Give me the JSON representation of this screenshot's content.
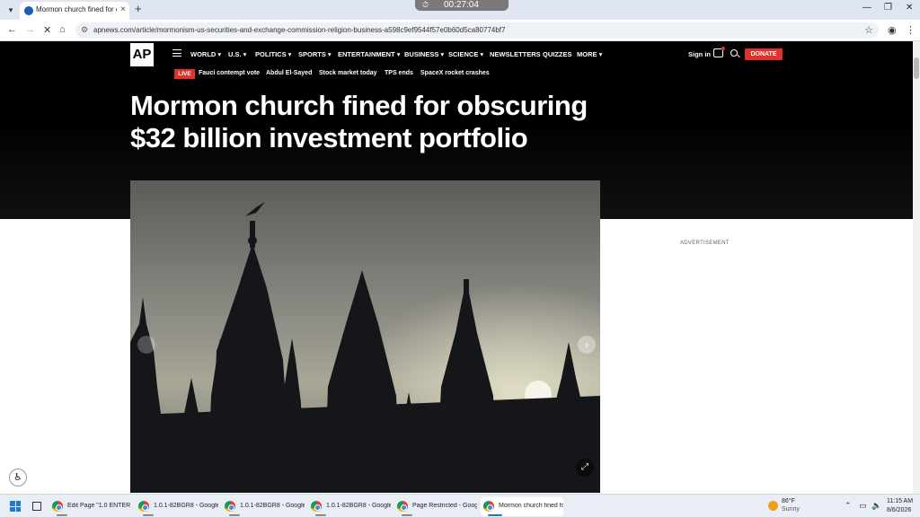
{
  "browser": {
    "tab_title": "Mormon church fined for obsc",
    "timer": "00:27:04",
    "url": "apnews.com/article/mormonism-us-securities-and-exchange-commission-religion-business-a598c9ef9544f57e0b60d5ca80774bf7"
  },
  "site": {
    "logo": "AP",
    "nav": [
      "WORLD",
      "U.S.",
      "POLITICS",
      "SPORTS",
      "ENTERTAINMENT",
      "BUSINESS",
      "SCIENCE",
      "NEWSLETTERS",
      "QUIZZES",
      "MORE"
    ],
    "sign_in": "Sign in",
    "donate": "DONATE",
    "live_label": "LIVE",
    "trending": [
      "Fauci contempt vote",
      "Abdul El-Sayed",
      "Stock market today",
      "TPS ends",
      "SpaceX rocket crashes"
    ]
  },
  "article": {
    "headline_line1": "Mormon church fined for obscuring",
    "headline_line2": "$32 billion investment portfolio",
    "advertisement_label": "ADVERTISEMENT"
  },
  "taskbar": {
    "apps": [
      "Edit Page \"1.0 ENTER HE",
      "1.0.1-82BGR8 - Google C",
      "1.0.1-82BGR8 - Google C",
      "1.0.1-82BGR8 - Google C",
      "Page Restricted - Googl",
      "Mormon church fined fo"
    ],
    "weather_temp": "86°F",
    "weather_cond": "Sunny",
    "time": "11:15 AM",
    "date": "8/6/2026"
  },
  "colors": {
    "ap_red": "#e0312c",
    "header_black": "#000000"
  }
}
